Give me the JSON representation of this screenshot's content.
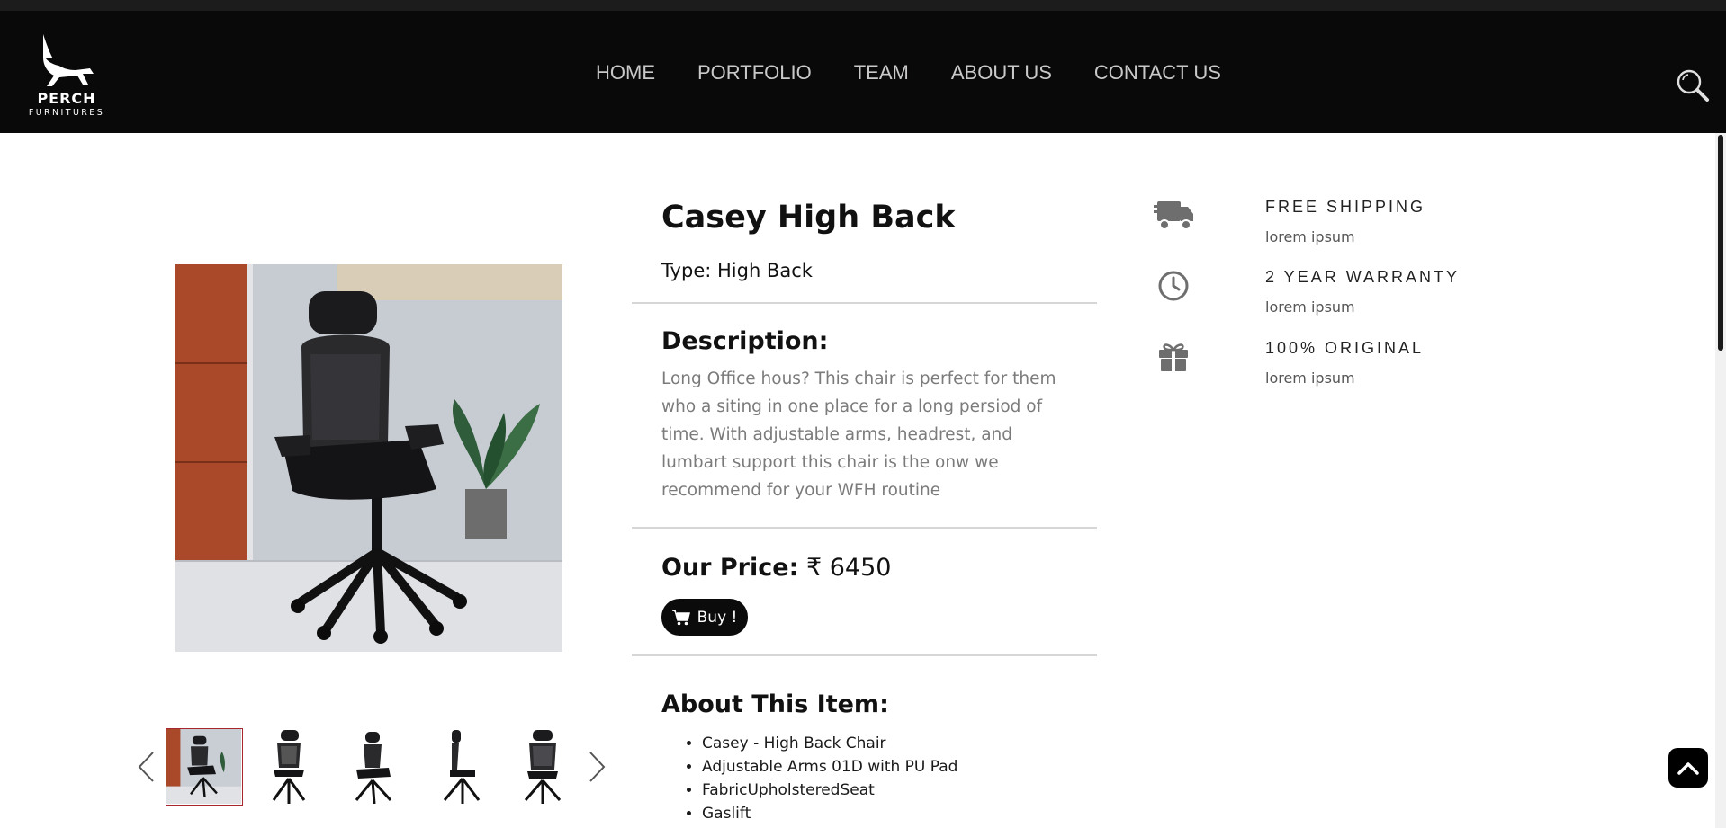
{
  "brand": {
    "name": "PERCH",
    "tagline": "FURNITURES"
  },
  "nav": {
    "items": [
      "HOME",
      "PORTFOLIO",
      "TEAM",
      "ABOUT US",
      "CONTACT US"
    ]
  },
  "product": {
    "title": "Casey High Back",
    "type_line": "Type: High Back",
    "description_heading": "Description:",
    "description": "Long Office hous? This chair is perfect for them who a siting in one place for a long persiod of time. With adjustable arms, headrest, and lumbart support this chair is the onw we recommend for your WFH routine",
    "price_label": "Our Price:",
    "price_value": "₹ 6450",
    "buy_label": "Buy !",
    "about_heading": "About This Item:",
    "about_items": [
      "Casey - High Back Chair",
      "Adjustable Arms 01D with PU Pad",
      "FabricUpholsteredSeat",
      "Gaslift"
    ]
  },
  "features": [
    {
      "icon": "truck-icon",
      "title": "FREE SHIPPING",
      "subtitle": "lorem ipsum"
    },
    {
      "icon": "clock-icon",
      "title": "2 YEAR WARRANTY",
      "subtitle": "lorem ipsum"
    },
    {
      "icon": "gift-icon",
      "title": "100% ORIGINAL",
      "subtitle": "lorem ipsum"
    }
  ],
  "colors": {
    "navbar": "#0a0909",
    "accent": "#a8272c",
    "text": "#111111",
    "muted": "#7b7b7b"
  }
}
